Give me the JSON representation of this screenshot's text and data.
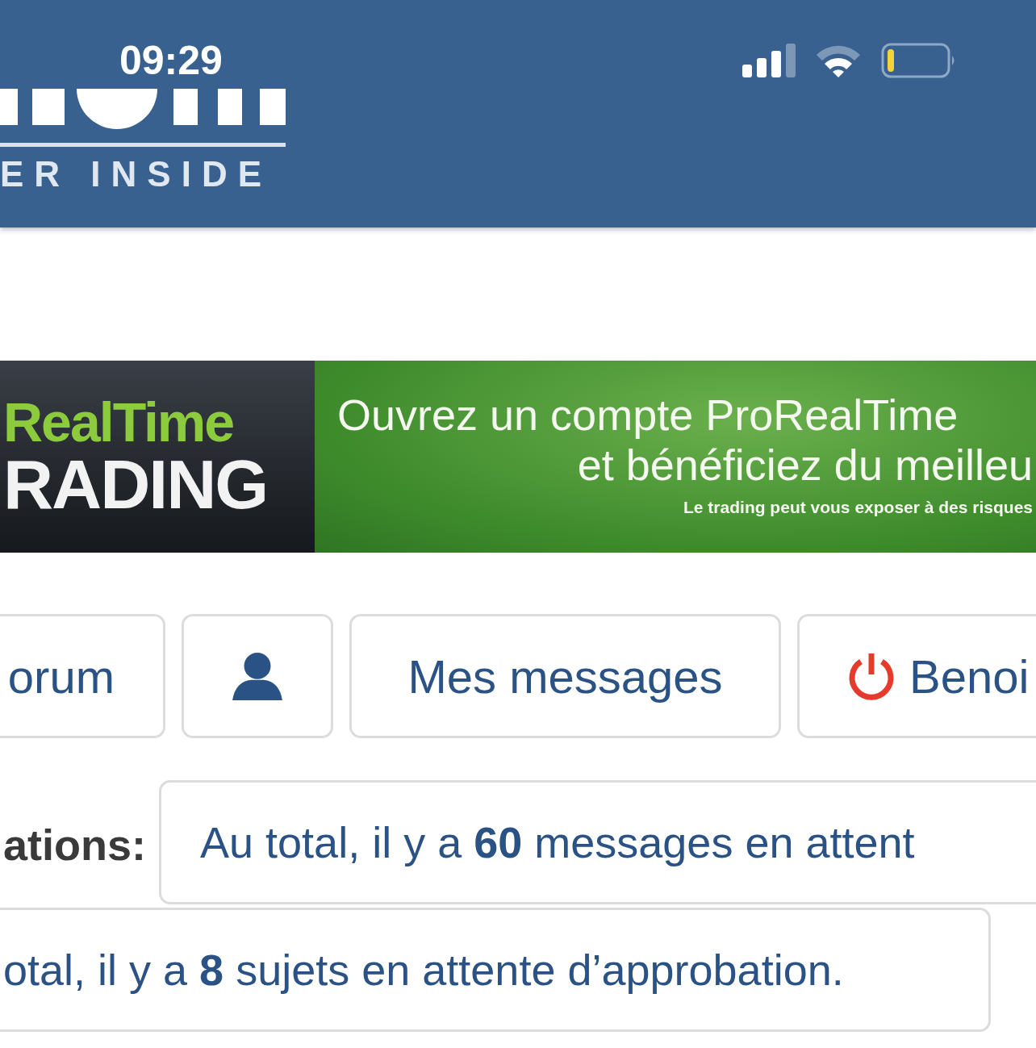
{
  "status_bar": {
    "time": "09:29"
  },
  "header": {
    "logo_tagline": "ER INSIDE"
  },
  "banner": {
    "brand_top": "RealTime",
    "brand_bottom": "RADING",
    "headline": "Ouvrez un compte ProRealTime",
    "subline": "et bénéficiez du meilleu",
    "disclaimer": "Le trading peut vous exposer à des risques"
  },
  "nav_buttons": [
    {
      "kind": "text",
      "label": "orum"
    },
    {
      "kind": "user"
    },
    {
      "kind": "text",
      "label": "Mes messages"
    },
    {
      "kind": "logout",
      "label": "Benoi"
    }
  ],
  "notifications": {
    "label": "ations:",
    "items": [
      "Au total, il y a **60** messages en attent",
      "otal, il y a **8** sujets en attente d’approbation."
    ]
  }
}
